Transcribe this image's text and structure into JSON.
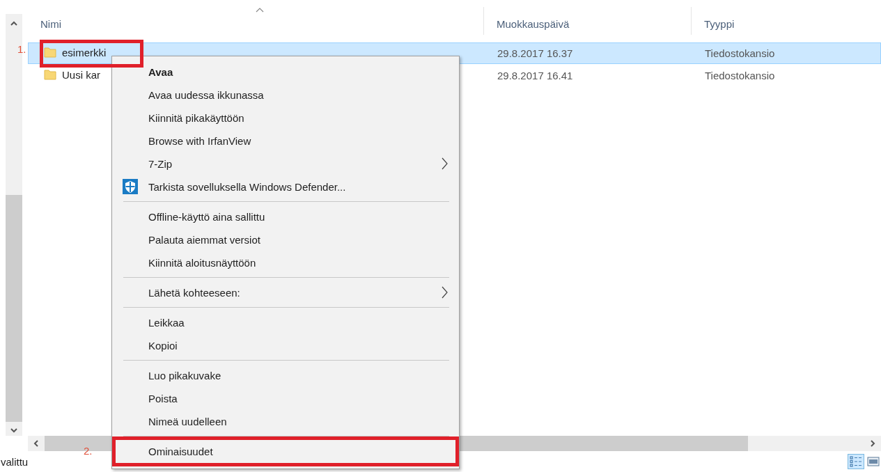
{
  "columns": [
    {
      "label": "Nimi",
      "sorted": true
    },
    {
      "label": "Muokkauspäivä",
      "sorted": false
    },
    {
      "label": "Tyyppi",
      "sorted": false
    }
  ],
  "rows": [
    {
      "name": "esimerkki",
      "date": "29.8.2017 16.37",
      "type": "Tiedostokansio",
      "selected": true,
      "callout": "1."
    },
    {
      "name": "Uusi kar",
      "date": "29.8.2017 16.41",
      "type": "Tiedostokansio",
      "selected": false
    }
  ],
  "context_menu": [
    [
      {
        "label": "Avaa",
        "default": true,
        "submenu": false,
        "icon": false
      },
      {
        "label": "Avaa uudessa ikkunassa",
        "default": false,
        "submenu": false,
        "icon": false
      },
      {
        "label": "Kiinnitä pikakäyttöön",
        "default": false,
        "submenu": false,
        "icon": false
      },
      {
        "label": "Browse with IrfanView",
        "default": false,
        "submenu": false,
        "icon": false
      },
      {
        "label": "7-Zip",
        "default": false,
        "submenu": true,
        "icon": false
      },
      {
        "label": "Tarkista sovelluksella Windows Defender...",
        "default": false,
        "submenu": false,
        "icon": true
      }
    ],
    [
      {
        "label": "Offline-käyttö aina sallittu",
        "default": false,
        "submenu": false,
        "icon": false
      },
      {
        "label": "Palauta aiemmat versiot",
        "default": false,
        "submenu": false,
        "icon": false
      },
      {
        "label": "Kiinnitä aloitusnäyttöön",
        "default": false,
        "submenu": false,
        "icon": false
      }
    ],
    [
      {
        "label": "Lähetä kohteeseen:",
        "default": false,
        "submenu": true,
        "icon": false
      }
    ],
    [
      {
        "label": "Leikkaa",
        "default": false,
        "submenu": false,
        "icon": false
      },
      {
        "label": "Kopioi",
        "default": false,
        "submenu": false,
        "icon": false
      }
    ],
    [
      {
        "label": "Luo pikakuvake",
        "default": false,
        "submenu": false,
        "icon": false
      },
      {
        "label": "Poista",
        "default": false,
        "submenu": false,
        "icon": false
      },
      {
        "label": "Nimeä uudelleen",
        "default": false,
        "submenu": false,
        "icon": false
      }
    ],
    [
      {
        "label": "Ominaisuudet",
        "default": false,
        "submenu": false,
        "icon": false,
        "callout": "2."
      }
    ]
  ],
  "status_bar": {
    "text": "valittu"
  }
}
